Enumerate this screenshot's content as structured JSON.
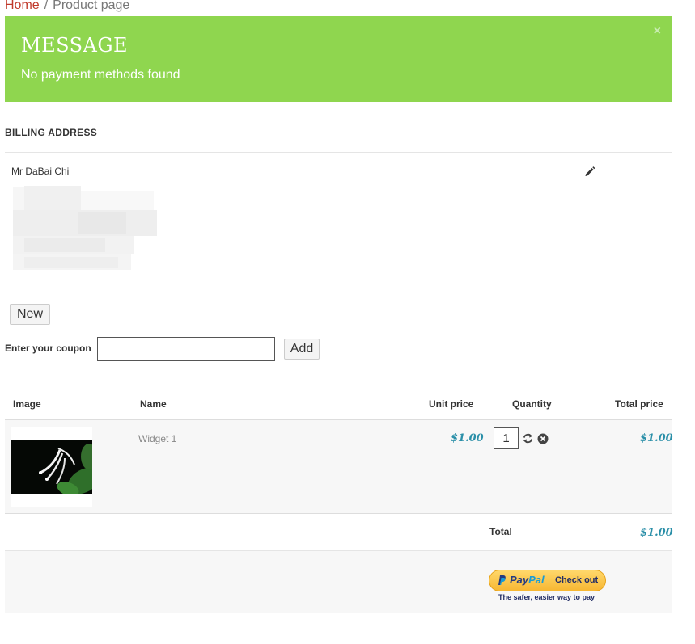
{
  "breadcrumb": {
    "home": "Home",
    "separator": "/",
    "current": "Product page"
  },
  "alert": {
    "title": "MESSAGE",
    "text": "No payment methods found",
    "close": "×",
    "color": "#8fd64f"
  },
  "billing": {
    "heading": "BILLING ADDRESS",
    "name": "Mr DaBai Chi"
  },
  "buttons": {
    "new": "New",
    "add": "Add"
  },
  "coupon": {
    "label": "Enter your coupon",
    "value": "",
    "placeholder": ""
  },
  "cart": {
    "columns": {
      "image": "Image",
      "name": "Name",
      "unit_price": "Unit price",
      "quantity": "Quantity",
      "total_price": "Total price"
    },
    "items": [
      {
        "name": "Widget 1",
        "unit_price": "$1.00",
        "quantity": "1",
        "total_price": "$1.00"
      }
    ],
    "total_label": "Total",
    "total_value": "$1.00"
  },
  "paypal": {
    "pay": "Pay",
    "pal": "Pal",
    "button_text": "Check out",
    "tagline": "The safer, easier way to pay"
  },
  "colors": {
    "link": "#c0392b",
    "price": "#2a8fa8"
  },
  "icons": {
    "edit": "pencil-icon",
    "refresh": "refresh-icon",
    "remove": "remove-icon",
    "close": "close-icon"
  }
}
